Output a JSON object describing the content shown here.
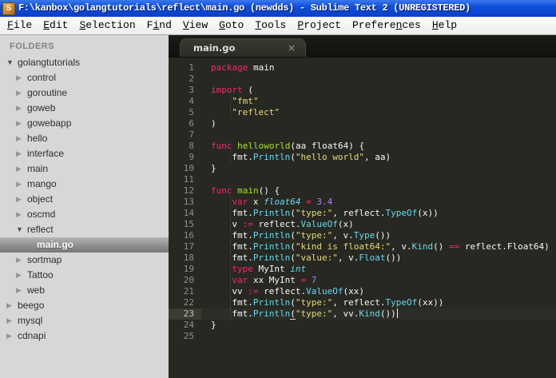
{
  "window": {
    "title": "F:\\kanbox\\golangtutorials\\reflect\\main.go (newdds) - Sublime Text 2 (UNREGISTERED)",
    "icon": "sublime-logo",
    "icon_letter": "S"
  },
  "colors": {
    "titlebar_blue": "#0d4fdc",
    "menubar_bg": "#f4f4f4",
    "sidebar_bg": "#d7d7d7",
    "sidebar_selection": "#8e8e8e",
    "editor_bg": "#272822",
    "gutter_text": "#8f908a",
    "code_default": "#f8f8f2",
    "keyword_pink": "#f92672",
    "function_green": "#a6e22e",
    "string_yellow": "#e6db74",
    "call_cyan": "#66d9ef",
    "number_purple": "#ae81ff"
  },
  "menu": {
    "items": [
      {
        "label": "File",
        "accel": 0
      },
      {
        "label": "Edit",
        "accel": 0
      },
      {
        "label": "Selection",
        "accel": 0
      },
      {
        "label": "Find",
        "accel": 1
      },
      {
        "label": "View",
        "accel": 0
      },
      {
        "label": "Goto",
        "accel": 0
      },
      {
        "label": "Tools",
        "accel": 0
      },
      {
        "label": "Project",
        "accel": 0
      },
      {
        "label": "Preferences",
        "accel": 7
      },
      {
        "label": "Help",
        "accel": 0
      }
    ]
  },
  "sidebar": {
    "header": "FOLDERS",
    "tree": [
      {
        "label": "golangtutorials",
        "depth": 0,
        "kind": "dir",
        "expanded": true,
        "selected": false
      },
      {
        "label": "control",
        "depth": 1,
        "kind": "dir",
        "expanded": false,
        "selected": false
      },
      {
        "label": "goroutine",
        "depth": 1,
        "kind": "dir",
        "expanded": false,
        "selected": false
      },
      {
        "label": "goweb",
        "depth": 1,
        "kind": "dir",
        "expanded": false,
        "selected": false
      },
      {
        "label": "gowebapp",
        "depth": 1,
        "kind": "dir",
        "expanded": false,
        "selected": false
      },
      {
        "label": "hello",
        "depth": 1,
        "kind": "dir",
        "expanded": false,
        "selected": false
      },
      {
        "label": "interface",
        "depth": 1,
        "kind": "dir",
        "expanded": false,
        "selected": false
      },
      {
        "label": "main",
        "depth": 1,
        "kind": "dir",
        "expanded": false,
        "selected": false
      },
      {
        "label": "mango",
        "depth": 1,
        "kind": "dir",
        "expanded": false,
        "selected": false
      },
      {
        "label": "object",
        "depth": 1,
        "kind": "dir",
        "expanded": false,
        "selected": false
      },
      {
        "label": "oscmd",
        "depth": 1,
        "kind": "dir",
        "expanded": false,
        "selected": false
      },
      {
        "label": "reflect",
        "depth": 1,
        "kind": "dir",
        "expanded": true,
        "selected": false
      },
      {
        "label": "main.go",
        "depth": 2,
        "kind": "file",
        "expanded": false,
        "selected": true
      },
      {
        "label": "sortmap",
        "depth": 1,
        "kind": "dir",
        "expanded": false,
        "selected": false
      },
      {
        "label": "Tattoo",
        "depth": 1,
        "kind": "dir",
        "expanded": false,
        "selected": false
      },
      {
        "label": "web",
        "depth": 1,
        "kind": "dir",
        "expanded": false,
        "selected": false
      },
      {
        "label": "beego",
        "depth": 0,
        "kind": "dir",
        "expanded": false,
        "selected": false
      },
      {
        "label": "mysql",
        "depth": 0,
        "kind": "dir",
        "expanded": false,
        "selected": false
      },
      {
        "label": "cdnapi",
        "depth": 0,
        "kind": "dir",
        "expanded": false,
        "selected": false
      }
    ]
  },
  "tabs": [
    {
      "label": "main.go",
      "close": "×",
      "active": true
    }
  ],
  "editor": {
    "cursor_line": 23,
    "lines": [
      {
        "n": 1,
        "t": [
          [
            "k",
            "package"
          ],
          [
            "w",
            " main"
          ]
        ]
      },
      {
        "n": 2,
        "t": []
      },
      {
        "n": 3,
        "t": [
          [
            "k",
            "import"
          ],
          [
            "w",
            " ("
          ]
        ]
      },
      {
        "n": 4,
        "t": [
          [
            "i",
            "    "
          ],
          [
            "s",
            "\"fmt\""
          ]
        ]
      },
      {
        "n": 5,
        "t": [
          [
            "i",
            "    "
          ],
          [
            "s",
            "\"reflect\""
          ]
        ]
      },
      {
        "n": 6,
        "t": [
          [
            "w",
            ")"
          ]
        ]
      },
      {
        "n": 7,
        "t": []
      },
      {
        "n": 8,
        "t": [
          [
            "k",
            "func"
          ],
          [
            "w",
            " "
          ],
          [
            "f",
            "helloworld"
          ],
          [
            "w",
            "(aa float64) {"
          ]
        ]
      },
      {
        "n": 9,
        "t": [
          [
            "i",
            "    "
          ],
          [
            "w",
            "fmt."
          ],
          [
            "c",
            "Println"
          ],
          [
            "w",
            "("
          ],
          [
            "s",
            "\"hello world\""
          ],
          [
            "w",
            ", aa)"
          ]
        ]
      },
      {
        "n": 10,
        "t": [
          [
            "w",
            "}"
          ]
        ]
      },
      {
        "n": 11,
        "t": []
      },
      {
        "n": 12,
        "t": [
          [
            "k",
            "func"
          ],
          [
            "w",
            " "
          ],
          [
            "f",
            "main"
          ],
          [
            "w",
            "() {"
          ]
        ]
      },
      {
        "n": 13,
        "t": [
          [
            "i",
            "    "
          ],
          [
            "k",
            "var"
          ],
          [
            "w",
            " x "
          ],
          [
            "t",
            "float64"
          ],
          [
            "w",
            " "
          ],
          [
            "k",
            "="
          ],
          [
            "w",
            " "
          ],
          [
            "n",
            "3.4"
          ]
        ]
      },
      {
        "n": 14,
        "t": [
          [
            "i",
            "    "
          ],
          [
            "w",
            "fmt."
          ],
          [
            "c",
            "Println"
          ],
          [
            "w",
            "("
          ],
          [
            "s",
            "\"type:\""
          ],
          [
            "w",
            ", reflect."
          ],
          [
            "c",
            "TypeOf"
          ],
          [
            "w",
            "(x))"
          ]
        ]
      },
      {
        "n": 15,
        "t": [
          [
            "i",
            "    "
          ],
          [
            "w",
            "v "
          ],
          [
            "k",
            ":="
          ],
          [
            "w",
            " reflect."
          ],
          [
            "c",
            "ValueOf"
          ],
          [
            "w",
            "(x)"
          ]
        ]
      },
      {
        "n": 16,
        "t": [
          [
            "i",
            "    "
          ],
          [
            "w",
            "fmt."
          ],
          [
            "c",
            "Println"
          ],
          [
            "w",
            "("
          ],
          [
            "s",
            "\"type:\""
          ],
          [
            "w",
            ", v."
          ],
          [
            "c",
            "Type"
          ],
          [
            "w",
            "())"
          ]
        ]
      },
      {
        "n": 17,
        "t": [
          [
            "i",
            "    "
          ],
          [
            "w",
            "fmt."
          ],
          [
            "c",
            "Println"
          ],
          [
            "w",
            "("
          ],
          [
            "s",
            "\"kind is float64:\""
          ],
          [
            "w",
            ", v."
          ],
          [
            "c",
            "Kind"
          ],
          [
            "w",
            "() "
          ],
          [
            "k",
            "=="
          ],
          [
            "w",
            " reflect.Float64)"
          ]
        ]
      },
      {
        "n": 18,
        "t": [
          [
            "i",
            "    "
          ],
          [
            "w",
            "fmt."
          ],
          [
            "c",
            "Println"
          ],
          [
            "w",
            "("
          ],
          [
            "s",
            "\"value:\""
          ],
          [
            "w",
            ", v."
          ],
          [
            "c",
            "Float"
          ],
          [
            "w",
            "())"
          ]
        ]
      },
      {
        "n": 19,
        "t": [
          [
            "i",
            "    "
          ],
          [
            "k",
            "type"
          ],
          [
            "w",
            " MyInt "
          ],
          [
            "t",
            "int"
          ]
        ]
      },
      {
        "n": 20,
        "t": [
          [
            "i",
            "    "
          ],
          [
            "k",
            "var"
          ],
          [
            "w",
            " xx MyInt "
          ],
          [
            "k",
            "="
          ],
          [
            "w",
            " "
          ],
          [
            "n",
            "7"
          ]
        ]
      },
      {
        "n": 21,
        "t": [
          [
            "i",
            "    "
          ],
          [
            "w",
            "vv "
          ],
          [
            "k",
            ":="
          ],
          [
            "w",
            " reflect."
          ],
          [
            "c",
            "ValueOf"
          ],
          [
            "w",
            "(xx)"
          ]
        ]
      },
      {
        "n": 22,
        "t": [
          [
            "i",
            "    "
          ],
          [
            "w",
            "fmt."
          ],
          [
            "c",
            "Println"
          ],
          [
            "w",
            "("
          ],
          [
            "s",
            "\"type:\""
          ],
          [
            "w",
            ", reflect."
          ],
          [
            "c",
            "TypeOf"
          ],
          [
            "w",
            "(xx))"
          ]
        ]
      },
      {
        "n": 23,
        "t": [
          [
            "i",
            "    "
          ],
          [
            "w",
            "fmt."
          ],
          [
            "c",
            "Println"
          ],
          [
            "u",
            "("
          ],
          [
            "s",
            "\"type:\""
          ],
          [
            "w",
            ", vv."
          ],
          [
            "c",
            "Kind"
          ],
          [
            "w",
            "())"
          ],
          [
            "caret",
            ""
          ]
        ]
      },
      {
        "n": 24,
        "t": [
          [
            "w",
            "}"
          ]
        ]
      },
      {
        "n": 25,
        "t": []
      }
    ]
  }
}
